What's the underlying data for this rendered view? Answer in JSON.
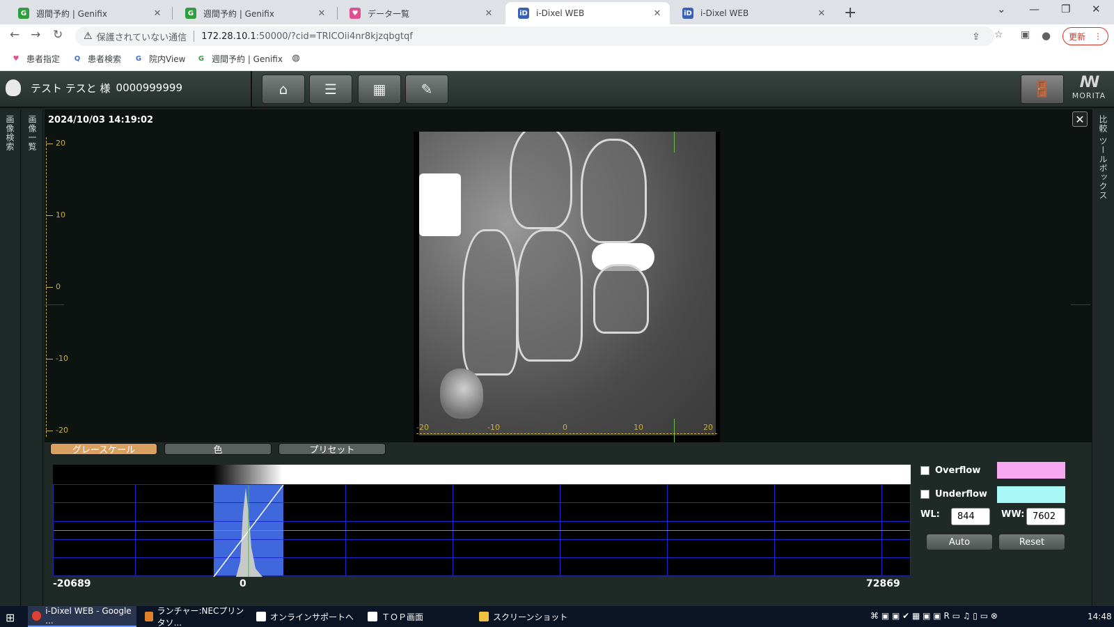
{
  "browser": {
    "tabs": [
      {
        "title": "週間予約 | Genifix",
        "favicon": "G",
        "color": "#2e9e3f"
      },
      {
        "title": "週間予約 | Genifix",
        "favicon": "G",
        "color": "#2e9e3f"
      },
      {
        "title": "データ一覧",
        "favicon": "tooth",
        "color": "#e05090"
      },
      {
        "title": "i-Dixel WEB",
        "favicon": "iD",
        "color": "#3a5fb8"
      },
      {
        "title": "i-Dixel WEB",
        "favicon": "iD",
        "color": "#3a5fb8"
      }
    ],
    "security_label": "保護されていない通信",
    "url_host": "172.28.10.1",
    "url_rest": ":50000/?cid=TRICOii4nr8kjzqbgtqf",
    "update_label": "更新",
    "bookmarks": [
      {
        "label": "患者指定",
        "favicon": "tooth"
      },
      {
        "label": "患者検索",
        "favicon": "search"
      },
      {
        "label": "院内View",
        "favicon": "G"
      },
      {
        "label": "週間予約 | Genifix",
        "favicon": "G"
      },
      {
        "label": "",
        "favicon": "globe"
      }
    ]
  },
  "app": {
    "patient_name": "テスト テスと 様",
    "patient_id": "0000999999",
    "toolbar": [
      "home-icon",
      "list-icon",
      "grid-icon",
      "edit-icon"
    ],
    "logo": "MORITA",
    "left_strip_1": "画像検索",
    "left_strip_2": "画像一覧",
    "right_strip": "比較 ツールボックス"
  },
  "viewer": {
    "timestamp": "2024/10/03 14:19:02",
    "y_ticks": [
      "20",
      "10",
      "0",
      "-10",
      "-20"
    ],
    "x_ticks": [
      "-20",
      "-10",
      "0",
      "10",
      "20"
    ]
  },
  "lut": {
    "tabs": [
      "グレースケール",
      "色",
      "プリセット"
    ],
    "active_tab": 0,
    "hist_min": "-20689",
    "hist_zero": "0",
    "hist_max": "72869",
    "overflow_label": "Overflow",
    "underflow_label": "Underflow",
    "overflow_color": "#f8a8f0",
    "underflow_color": "#a8f8f8",
    "wl_label": "WL:",
    "wl_value": "844",
    "ww_label": "WW:",
    "ww_value": "7602",
    "auto_label": "Auto",
    "reset_label": "Reset"
  },
  "taskbar": {
    "items": [
      {
        "label": "i-Dixel WEB - Google ...",
        "color": "#e04030"
      },
      {
        "label": "ランチャー:NECプリンタソ...",
        "color": "#e0802a"
      },
      {
        "label": "オンラインサポートへ",
        "color": "#ffffff"
      },
      {
        "label": "ＴＯＰ画面",
        "color": "#ffffff"
      },
      {
        "label": "スクリーンショット",
        "color": "#f0c040"
      }
    ],
    "time": "14:48"
  }
}
